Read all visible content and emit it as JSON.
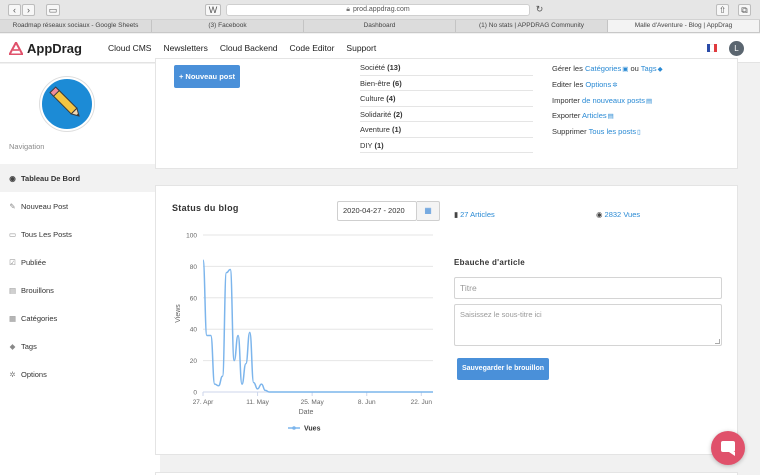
{
  "browser": {
    "url": "prod.appdrag.com",
    "tabs": [
      {
        "label": "Roadmap réseaux sociaux - Google Sheets",
        "active": false
      },
      {
        "label": "(3) Facebook",
        "active": false
      },
      {
        "label": "Dashboard",
        "active": false
      },
      {
        "label": "(1) No stats | APPDRAG Community",
        "active": false
      },
      {
        "label": "Malle d'Aventure - Blog | AppDrag",
        "active": true
      }
    ]
  },
  "header": {
    "logo": "AppDrag",
    "menu": [
      "Cloud CMS",
      "Newsletters",
      "Cloud Backend",
      "Code Editor",
      "Support"
    ],
    "avatar_letter": "L",
    "accent": "#e0516b"
  },
  "sidebar": {
    "nav_title": "Navigation",
    "items": [
      {
        "label": "Tableau De Bord",
        "icon": "dashboard-icon",
        "glyph": "◉",
        "active": true
      },
      {
        "label": "Nouveau Post",
        "icon": "edit-icon",
        "glyph": "✎",
        "active": false
      },
      {
        "label": "Tous Les Posts",
        "icon": "folder-icon",
        "glyph": "▭",
        "active": false
      },
      {
        "label": "Publiée",
        "icon": "check-square-icon",
        "glyph": "☑",
        "active": false
      },
      {
        "label": "Brouillons",
        "icon": "file-icon",
        "glyph": "▤",
        "active": false
      },
      {
        "label": "Catégories",
        "icon": "list-icon",
        "glyph": "▦",
        "active": false
      },
      {
        "label": "Tags",
        "icon": "tag-icon",
        "glyph": "◆",
        "active": false
      },
      {
        "label": "Options",
        "icon": "gear-icon",
        "glyph": "✲",
        "active": false
      }
    ]
  },
  "top_card": {
    "new_post_button": "+ Nouveau post",
    "categories": [
      {
        "name": "Société",
        "count": "(13)"
      },
      {
        "name": "Bien-être",
        "count": "(6)"
      },
      {
        "name": "Culture",
        "count": "(4)"
      },
      {
        "name": "Solidarité",
        "count": "(2)"
      },
      {
        "name": "Aventure",
        "count": "(1)"
      },
      {
        "name": "DIY",
        "count": "(1)"
      }
    ],
    "actions": {
      "manage_prefix": "Gérer les",
      "manage_categories": "Catégories",
      "manage_or": "ou",
      "manage_tags": "Tags",
      "edit_prefix": "Editer les",
      "edit_options": "Options",
      "import_prefix": "Importer",
      "import_link": "de nouveaux posts",
      "export_prefix": "Exporter",
      "export_link": "Articles",
      "delete_prefix": "Supprimer",
      "delete_link": "Tous les posts"
    }
  },
  "blog_status": {
    "title": "Status du blog",
    "date_range": "2020-04-27 - 2020",
    "articles": "27 Articles",
    "views": "2832 Vues"
  },
  "draft": {
    "title": "Ebauche d'article",
    "title_placeholder": "Titre",
    "subtitle_placeholder": "Saisissez le sous-titre ici",
    "save_button": "Sauvegarder le brouillon"
  },
  "chart_data": {
    "type": "line",
    "title": "",
    "xlabel": "Date",
    "ylabel": "Views",
    "ylim": [
      0,
      100
    ],
    "yticks": [
      0,
      20,
      40,
      60,
      80,
      100
    ],
    "xlim": [
      "2020-04-27",
      "2020-06-25"
    ],
    "xticks": [
      {
        "label": "27. Apr",
        "date": "2020-04-27"
      },
      {
        "label": "11. May",
        "date": "2020-05-11"
      },
      {
        "label": "25. May",
        "date": "2020-05-25"
      },
      {
        "label": "8. Jun",
        "date": "2020-06-08"
      },
      {
        "label": "22. Jun",
        "date": "2020-06-22"
      }
    ],
    "grid": true,
    "legend": "bottom-center",
    "series": [
      {
        "name": "Vues",
        "color": "#7cb5ec",
        "points": [
          [
            "2020-04-27",
            84
          ],
          [
            "2020-04-28",
            36
          ],
          [
            "2020-04-29",
            36
          ],
          [
            "2020-04-30",
            5
          ],
          [
            "2020-05-01",
            4
          ],
          [
            "2020-05-02",
            10
          ],
          [
            "2020-05-03",
            76
          ],
          [
            "2020-05-04",
            78
          ],
          [
            "2020-05-05",
            20
          ],
          [
            "2020-05-06",
            36
          ],
          [
            "2020-05-07",
            5
          ],
          [
            "2020-05-08",
            18
          ],
          [
            "2020-05-09",
            38
          ],
          [
            "2020-05-10",
            6
          ],
          [
            "2020-05-11",
            2
          ],
          [
            "2020-05-12",
            5
          ],
          [
            "2020-05-13",
            1
          ],
          [
            "2020-05-14",
            0
          ],
          [
            "2020-05-20",
            0
          ],
          [
            "2020-06-01",
            0
          ],
          [
            "2020-06-15",
            0
          ],
          [
            "2020-06-25",
            0
          ]
        ]
      }
    ]
  }
}
